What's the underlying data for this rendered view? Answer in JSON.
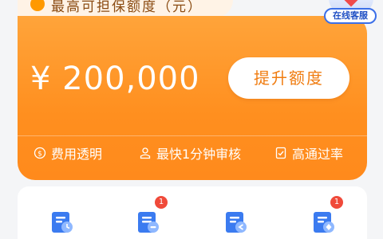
{
  "header": {
    "label": "最高可担保额度（元）"
  },
  "customer_service": {
    "label": "在线客服"
  },
  "card": {
    "amount": "¥ 200,000",
    "raise_button": "提升额度",
    "features": [
      {
        "icon": "dollar-circle-icon",
        "label": "费用透明"
      },
      {
        "icon": "person-icon",
        "label": "最快1分钟审核"
      },
      {
        "icon": "approval-doc-icon",
        "label": "高通过率"
      }
    ]
  },
  "shortcuts": [
    {
      "icon": "document-clock-icon",
      "badge": ""
    },
    {
      "icon": "document-list-icon",
      "badge": "1"
    },
    {
      "icon": "document-arrow-icon",
      "badge": ""
    },
    {
      "icon": "document-settings-icon",
      "badge": "1"
    }
  ],
  "colors": {
    "brand_orange": "#ff8f1f",
    "button_text": "#f07c10",
    "badge_red": "#f04a3a",
    "icon_blue": "#3b7bf0"
  }
}
